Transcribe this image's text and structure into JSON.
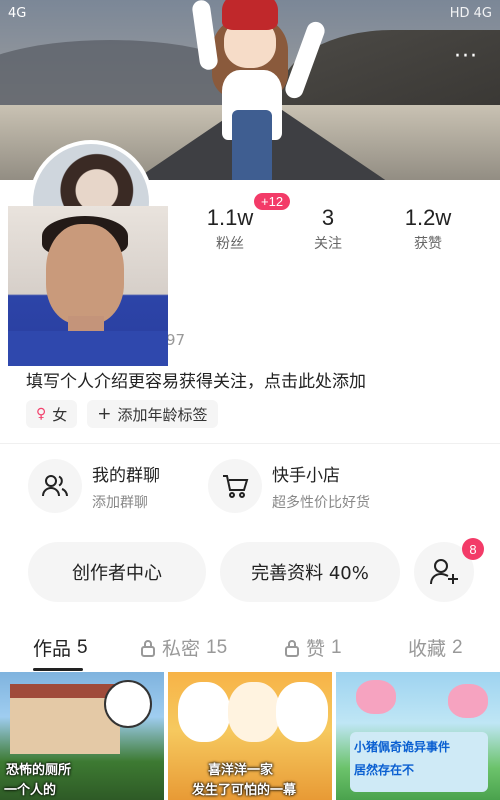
{
  "status_bar": {
    "left": "4G",
    "right": "HD 4G"
  },
  "stats": {
    "fans": {
      "value": "1.1w",
      "label": "粉丝",
      "delta": "+12"
    },
    "following": {
      "value": "3",
      "label": "关注"
    },
    "likes": {
      "value": "1.2w",
      "label": "获赞"
    }
  },
  "id_fragment": "97",
  "bio_prompt": "填写个人介绍更容易获得关注，点击此处添加",
  "tags": {
    "gender": "女",
    "add_age": "添加年龄标签"
  },
  "entries": {
    "group_chat": {
      "title": "我的群聊",
      "subtitle": "添加群聊"
    },
    "shop": {
      "title": "快手小店",
      "subtitle": "超多性价比好货"
    }
  },
  "actions": {
    "creator_center": "创作者中心",
    "complete_profile": "完善资料 40%",
    "add_friend_badge": "8"
  },
  "tabs": [
    {
      "label": "作品",
      "count": "5"
    },
    {
      "label": "私密",
      "count": "15"
    },
    {
      "label": "赞",
      "count": "1"
    },
    {
      "label": "收藏",
      "count": "2"
    }
  ],
  "thumbnails": [
    {
      "caption_top": "恐怖的厕所",
      "caption_bottom": "一个人的"
    },
    {
      "caption_top": "喜洋洋一家",
      "caption_bottom": "发生了可怕的一幕"
    },
    {
      "caption_top": "小猪佩奇诡异事件",
      "caption_bottom": "居然存在不"
    }
  ],
  "colors": {
    "accent_pink": "#f33b68",
    "tile_bg": "#f5f5f5"
  }
}
